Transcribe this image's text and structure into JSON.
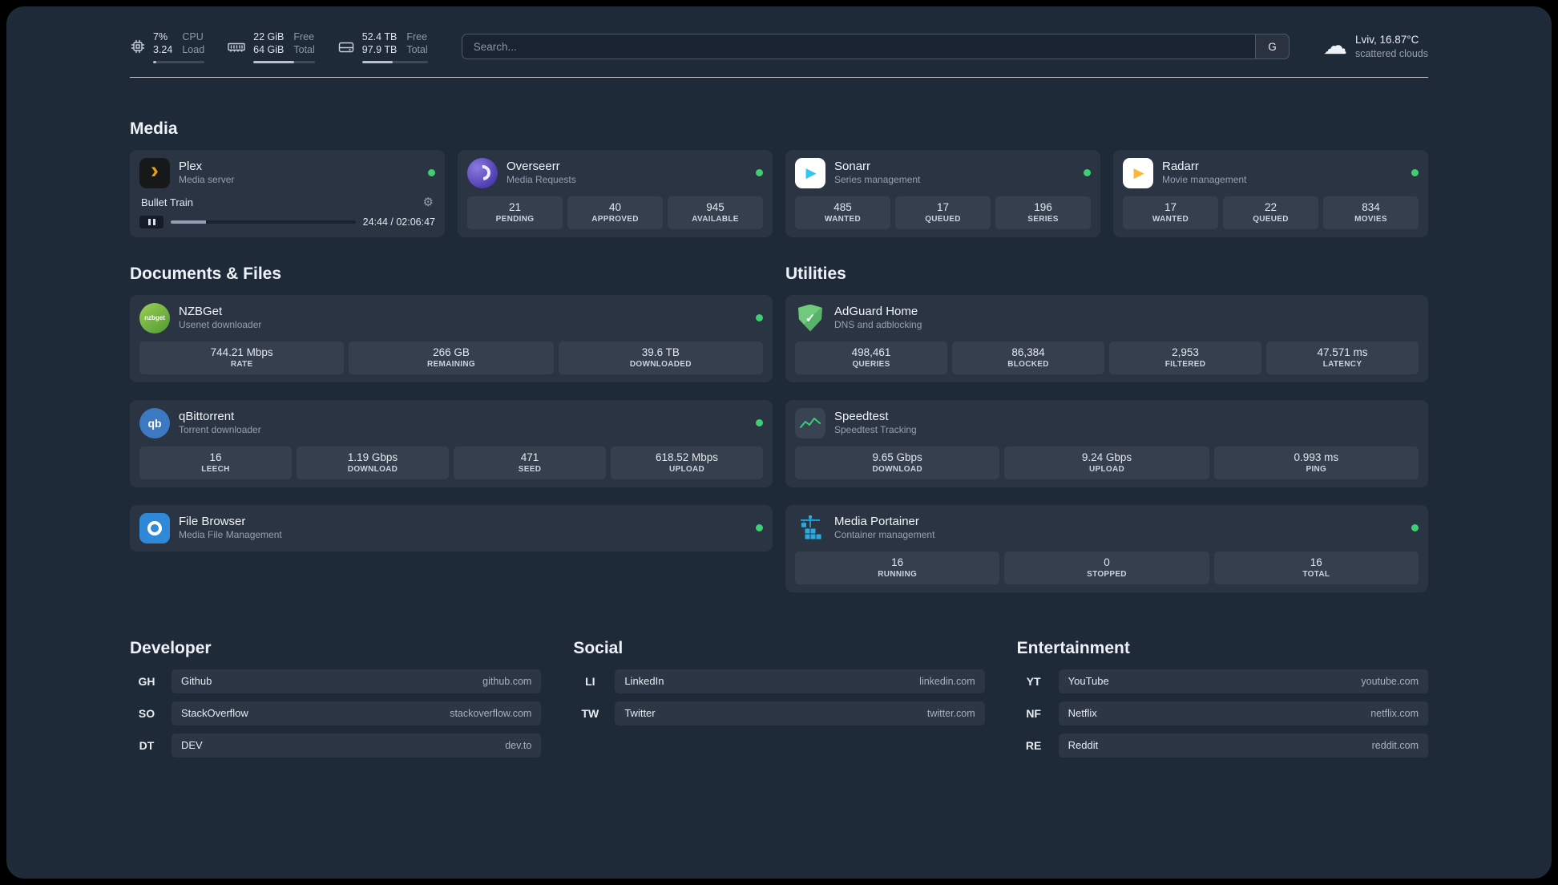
{
  "colors": {
    "page_bg": "#1f2a39",
    "card_bg": "rgba(255,255,255,0.05)",
    "tile_bg": "rgba(255,255,255,0.06)",
    "status_online": "#3ecf72",
    "plex_amber": "#e5a00d",
    "sonarr_blue": "#35c5f1",
    "radarr_amber": "#ffb53c",
    "portainer_blue": "#29abe2",
    "speedtest_green": "#31d07a"
  },
  "icons": {
    "cloud": "☁",
    "gear": "⚙",
    "plex_chevron": "›",
    "sonarr_play": "▶",
    "radarr_play": "▶",
    "adguard_check": "✓",
    "nzbget_label": "nzbget",
    "qbittorrent_label": "qb"
  },
  "header": {
    "cpu": {
      "value": "7%",
      "sub": "3.24",
      "label": "CPU",
      "sublabel": "Load",
      "bar_percent": 7
    },
    "memory": {
      "value": "22 GiB",
      "sub": "64 GiB",
      "label": "Free",
      "sublabel": "Total",
      "bar_percent": 66
    },
    "disk": {
      "value": "52.4 TB",
      "sub": "97.9 TB",
      "label": "Free",
      "sublabel": "Total",
      "bar_percent": 47
    },
    "search": {
      "placeholder": "Search...",
      "provider": "G"
    },
    "weather": {
      "location": "Lviv, 16.87°C",
      "condition": "scattered clouds"
    }
  },
  "sections": {
    "media": "Media",
    "documents": "Documents & Files",
    "utilities": "Utilities",
    "developer": "Developer",
    "social": "Social",
    "entertainment": "Entertainment"
  },
  "media_apps": {
    "plex": {
      "name": "Plex",
      "desc": "Media server",
      "track": "Bullet Train",
      "time": "24:44 / 02:06:47",
      "progress_percent": 19
    },
    "overseerr": {
      "name": "Overseerr",
      "desc": "Media Requests",
      "stats": [
        {
          "value": "21",
          "label": "PENDING"
        },
        {
          "value": "40",
          "label": "APPROVED"
        },
        {
          "value": "945",
          "label": "AVAILABLE"
        }
      ]
    },
    "sonarr": {
      "name": "Sonarr",
      "desc": "Series management",
      "stats": [
        {
          "value": "485",
          "label": "WANTED"
        },
        {
          "value": "17",
          "label": "QUEUED"
        },
        {
          "value": "196",
          "label": "SERIES"
        }
      ]
    },
    "radarr": {
      "name": "Radarr",
      "desc": "Movie management",
      "stats": [
        {
          "value": "17",
          "label": "WANTED"
        },
        {
          "value": "22",
          "label": "QUEUED"
        },
        {
          "value": "834",
          "label": "MOVIES"
        }
      ]
    }
  },
  "documents_apps": {
    "nzbget": {
      "name": "NZBGet",
      "desc": "Usenet downloader",
      "stats": [
        {
          "value": "744.21 Mbps",
          "label": "RATE"
        },
        {
          "value": "266 GB",
          "label": "REMAINING"
        },
        {
          "value": "39.6 TB",
          "label": "DOWNLOADED"
        }
      ]
    },
    "qbittorrent": {
      "name": "qBittorrent",
      "desc": "Torrent downloader",
      "stats": [
        {
          "value": "16",
          "label": "LEECH"
        },
        {
          "value": "1.19 Gbps",
          "label": "DOWNLOAD"
        },
        {
          "value": "471",
          "label": "SEED"
        },
        {
          "value": "618.52 Mbps",
          "label": "UPLOAD"
        }
      ]
    },
    "filebrowser": {
      "name": "File Browser",
      "desc": "Media File Management"
    }
  },
  "utilities_apps": {
    "adguard": {
      "name": "AdGuard Home",
      "desc": "DNS and adblocking",
      "stats": [
        {
          "value": "498,461",
          "label": "QUERIES"
        },
        {
          "value": "86,384",
          "label": "BLOCKED"
        },
        {
          "value": "2,953",
          "label": "FILTERED"
        },
        {
          "value": "47.571 ms",
          "label": "LATENCY"
        }
      ]
    },
    "speedtest": {
      "name": "Speedtest",
      "desc": "Speedtest Tracking",
      "stats": [
        {
          "value": "9.65 Gbps",
          "label": "DOWNLOAD"
        },
        {
          "value": "9.24 Gbps",
          "label": "UPLOAD"
        },
        {
          "value": "0.993 ms",
          "label": "PING"
        }
      ]
    },
    "portainer": {
      "name": "Media Portainer",
      "desc": "Container management",
      "stats": [
        {
          "value": "16",
          "label": "RUNNING"
        },
        {
          "value": "0",
          "label": "STOPPED"
        },
        {
          "value": "16",
          "label": "TOTAL"
        }
      ]
    }
  },
  "bookmarks": {
    "developer": [
      {
        "abbr": "GH",
        "name": "Github",
        "url": "github.com"
      },
      {
        "abbr": "SO",
        "name": "StackOverflow",
        "url": "stackoverflow.com"
      },
      {
        "abbr": "DT",
        "name": "DEV",
        "url": "dev.to"
      }
    ],
    "social": [
      {
        "abbr": "LI",
        "name": "LinkedIn",
        "url": "linkedin.com"
      },
      {
        "abbr": "TW",
        "name": "Twitter",
        "url": "twitter.com"
      }
    ],
    "entertainment": [
      {
        "abbr": "YT",
        "name": "YouTube",
        "url": "youtube.com"
      },
      {
        "abbr": "NF",
        "name": "Netflix",
        "url": "netflix.com"
      },
      {
        "abbr": "RE",
        "name": "Reddit",
        "url": "reddit.com"
      }
    ]
  }
}
